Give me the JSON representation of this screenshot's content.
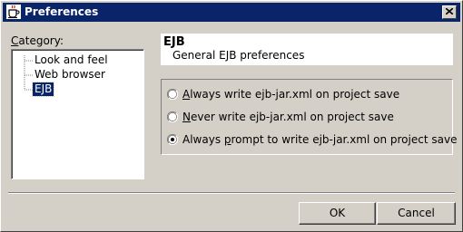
{
  "window": {
    "title": "Preferences",
    "close_icon": "close-icon",
    "app_icon": "java-cup-icon"
  },
  "category": {
    "label_accel": "C",
    "label_rest": "ategory:",
    "items": [
      {
        "label": "Look and feel",
        "selected": false
      },
      {
        "label": "Web browser",
        "selected": false
      },
      {
        "label": "EJB",
        "selected": true
      }
    ]
  },
  "panel": {
    "title": "EJB",
    "subtitle": "General EJB preferences"
  },
  "options": [
    {
      "pre": "",
      "accel": "A",
      "post": "lways write ejb-jar.xml on project save",
      "checked": false
    },
    {
      "pre": "",
      "accel": "N",
      "post": "ever write ejb-jar.xml on project save",
      "checked": false
    },
    {
      "pre": "Always ",
      "accel": "p",
      "post": "rompt to write ejb-jar.xml on project save",
      "checked": true
    }
  ],
  "buttons": {
    "ok": "OK",
    "cancel": "Cancel"
  },
  "colors": {
    "titlebar": "#0a246a",
    "face": "#d4d0c8",
    "selection": "#0a246a"
  }
}
